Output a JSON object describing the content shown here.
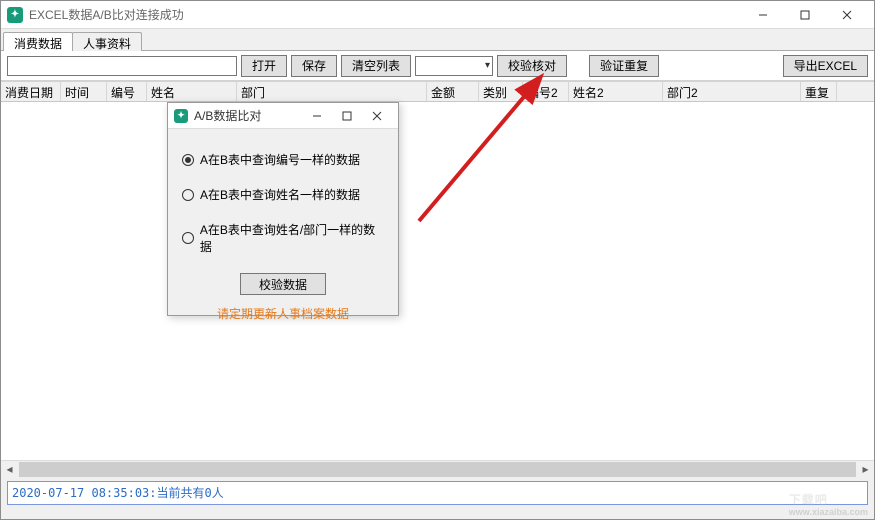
{
  "window": {
    "title": "EXCEL数据A/B比对连接成功"
  },
  "tabs": {
    "tab1": "消费数据",
    "tab2": "人事资料"
  },
  "toolbar": {
    "input_value": "",
    "open": "打开",
    "save": "保存",
    "clear_list": "清空列表",
    "dropdown_value": "",
    "check": "校验核对",
    "verify_dup": "验证重复",
    "export": "导出EXCEL"
  },
  "columns": {
    "date": "消费日期",
    "time": "时间",
    "no": "编号",
    "name": "姓名",
    "dept": "部门",
    "amount": "金额",
    "category": "类别",
    "no2": "编号2",
    "name2": "姓名2",
    "dept2": "部门2",
    "repeat": "重复"
  },
  "dialog": {
    "title": "A/B数据比对",
    "opt1": "A在B表中查询编号一样的数据",
    "opt2": "A在B表中查询姓名一样的数据",
    "opt3": "A在B表中查询姓名/部门一样的数据",
    "selected": "opt1",
    "action": "校验数据",
    "footer": "请定期更新人事档案数据"
  },
  "status": {
    "text": "2020-07-17 08:35:03:当前共有0人"
  },
  "watermark": {
    "main": "下载吧",
    "sub": "www.xiazaiba.com"
  }
}
